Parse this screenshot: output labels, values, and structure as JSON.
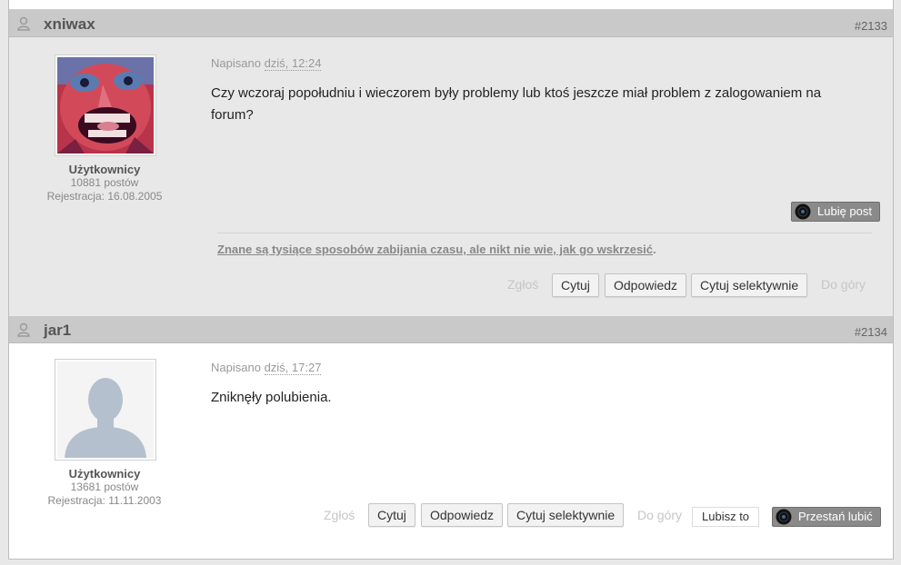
{
  "posts": [
    {
      "username": "xniwax",
      "number": "#2133",
      "group": "Użytkownicy",
      "post_count": "10881 postów",
      "registered": "Rejestracja: 16.08.2005",
      "posted_label": "Napisano",
      "posted_date": "dziś, 12:24",
      "body": "Czy wczoraj popołudniu i wieczorem były problemy lub ktoś jeszcze miał problem z zalogowaniem na forum?",
      "like_label": "Lubię post",
      "signature": "Znane są tysiące sposobów zabijania czasu, ale nikt nie wie, jak go wskrzesić",
      "signature_end": ".",
      "actions": {
        "report": "Zgłoś",
        "quote": "Cytuj",
        "reply": "Odpowiedz",
        "quote_selective": "Cytuj selektywnie",
        "top": "Do góry"
      }
    },
    {
      "username": "jar1",
      "number": "#2134",
      "group": "Użytkownicy",
      "post_count": "13681 postów",
      "registered": "Rejestracja: 11.11.2003",
      "posted_label": "Napisano",
      "posted_date": "dziś, 17:27",
      "body": "Zniknęły polubienia.",
      "you_like": "Lubisz to",
      "unlike_label": "Przestań lubić",
      "actions": {
        "report": "Zgłoś",
        "quote": "Cytuj",
        "reply": "Odpowiedz",
        "quote_selective": "Cytuj selektywnie",
        "top": "Do góry"
      }
    }
  ],
  "colors": {
    "header_bg": "#c9c9c9",
    "post_alt_bg": "#e8e8e8",
    "like_bg": "#8a8a8a"
  }
}
